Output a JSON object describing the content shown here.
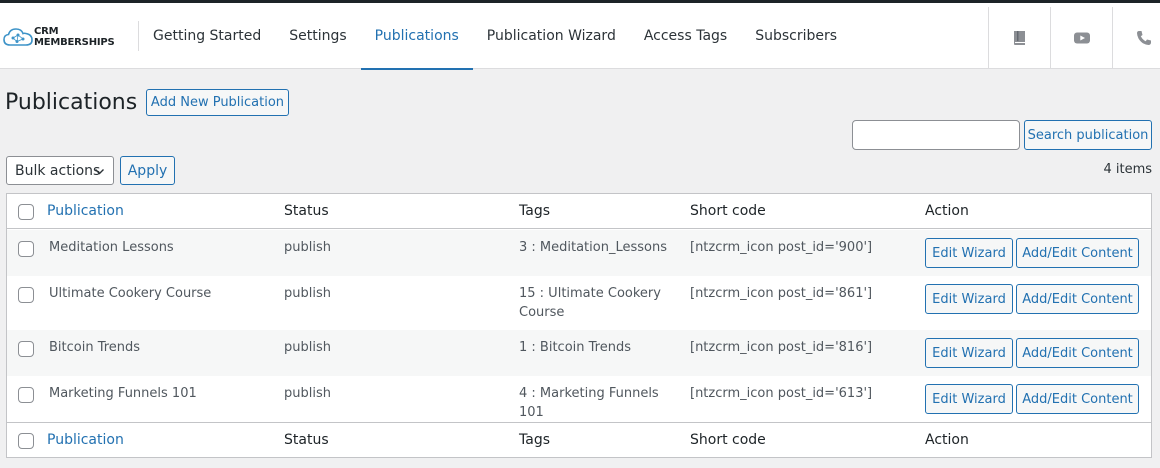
{
  "brand": {
    "line1": "CRM",
    "line2": "MEMBERSHIPS",
    "icon": "cloud-network-icon"
  },
  "nav": {
    "items": [
      {
        "label": "Getting Started"
      },
      {
        "label": "Settings"
      },
      {
        "label": "Publications",
        "active": true
      },
      {
        "label": "Publication Wizard"
      },
      {
        "label": "Access Tags"
      },
      {
        "label": "Subscribers"
      }
    ],
    "accent": "#2271b1"
  },
  "toolbar_icons": [
    "book-icon",
    "youtube-icon",
    "phone-icon"
  ],
  "page": {
    "title": "Publications",
    "add_new_label": "Add New Publication",
    "search_button_label": "Search publication",
    "search_value": "",
    "bulk_actions_label": "Bulk actions",
    "apply_label": "Apply",
    "items_count": "4 items"
  },
  "table": {
    "columns": {
      "publication": "Publication",
      "status": "Status",
      "tags": "Tags",
      "short_code": "Short code",
      "action": "Action"
    },
    "edit_wizard_label": "Edit Wizard",
    "add_edit_label": "Add/Edit Content",
    "rows": [
      {
        "publication": "Meditation Lessons",
        "status": "publish",
        "tags": "3 : Meditation_Lessons",
        "short_code": "[ntzcrm_icon post_id='900']"
      },
      {
        "publication": "Ultimate Cookery Course",
        "status": "publish",
        "tags": "15 : Ultimate Cookery Course",
        "short_code": "[ntzcrm_icon post_id='861']"
      },
      {
        "publication": "Bitcoin Trends",
        "status": "publish",
        "tags": "1 : Bitcoin Trends",
        "short_code": "[ntzcrm_icon post_id='816']"
      },
      {
        "publication": "Marketing Funnels 101",
        "status": "publish",
        "tags": "4 : Marketing Funnels 101",
        "short_code": "[ntzcrm_icon post_id='613']"
      }
    ]
  }
}
